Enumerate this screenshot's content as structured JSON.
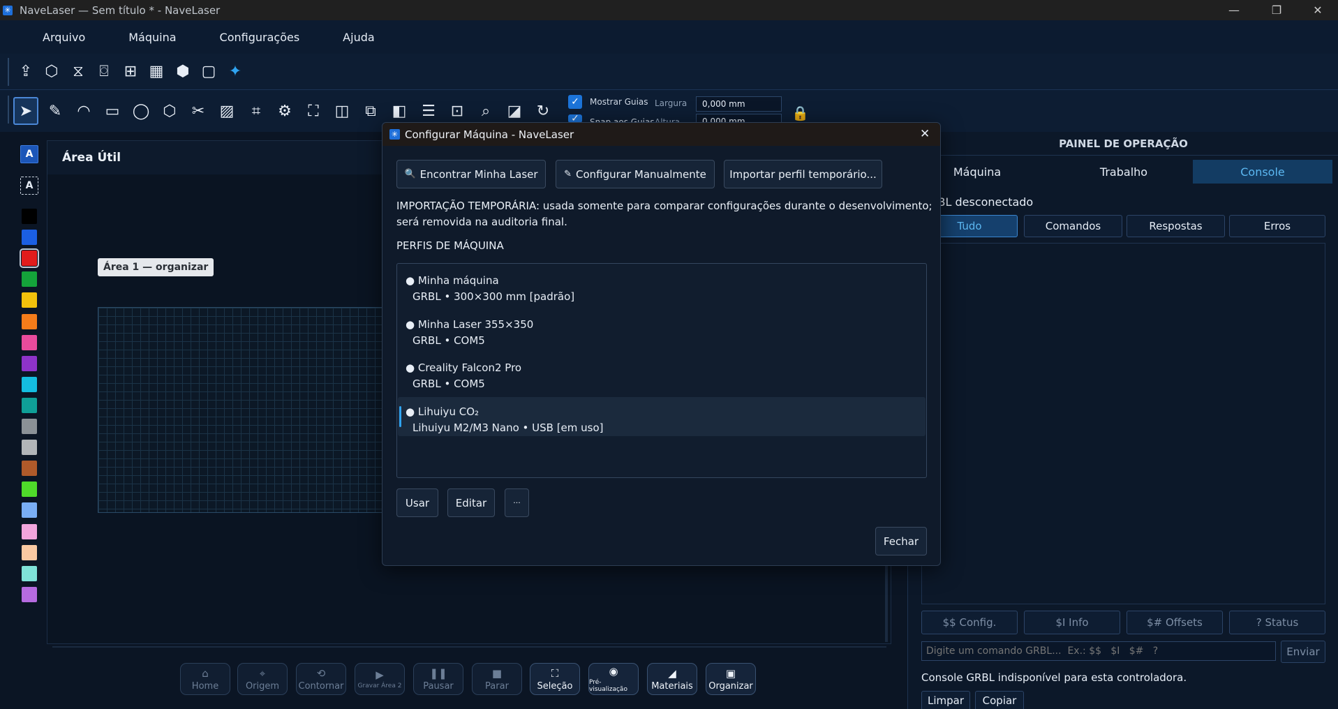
{
  "window": {
    "title": "NaveLaser — Sem título * - NaveLaser",
    "min_label": "—",
    "max_label": "❐",
    "close_label": "✕"
  },
  "menu": [
    "Arquivo",
    "Máquina",
    "Configurações",
    "Ajuda"
  ],
  "toolbar_icons": [
    "export-icon",
    "laser-head-icon",
    "mirror-icon",
    "camera-icon",
    "grid-array-icon",
    "qr-code-icon",
    "box-icon",
    "new-document-icon",
    "sparkle-icon"
  ],
  "tools_icons": [
    "select-tool-icon",
    "pen-tool-icon",
    "arc-tool-icon",
    "rectangle-tool-icon",
    "ellipse-tool-icon",
    "polygon-tool-icon",
    "scissors-icon",
    "image-icon",
    "crop-icon",
    "node-edit-icon",
    "bounding-box-icon",
    "rounded-corner-icon",
    "group-icon",
    "flip-icon",
    "align-icon",
    "offset-icon",
    "zoom-icon",
    "measure-icon",
    "rotate-icon"
  ],
  "guides": {
    "show_label": "Mostrar Guias",
    "snap_label": "Snap aos Guias",
    "width_label": "Largura",
    "height_label": "Altura",
    "width_value": "0,000 mm",
    "height_value": "0,000 mm"
  },
  "palette": {
    "text_btn": "A",
    "text_btn2": "A",
    "colors": [
      "#000000",
      "#1b5fe3",
      "#e11c1c",
      "#14a33a",
      "#f2c10c",
      "#f57c1a",
      "#e94b9c",
      "#8e33c9",
      "#14bde0",
      "#0f9f97",
      "#8b9196",
      "#b2b5b8",
      "#b05a2a",
      "#4fdb2a",
      "#7aaef5",
      "#f2a5dd",
      "#f9c9a2",
      "#7fe2d8",
      "#b66be0"
    ]
  },
  "workspace": {
    "title": "Área Útil",
    "area_label": "Área 1 — organizar"
  },
  "bottom_bar": [
    {
      "label": "Home",
      "icon": "⌂",
      "enabled": false
    },
    {
      "label": "Origem",
      "icon": "⌖",
      "enabled": false
    },
    {
      "label": "Contornar",
      "icon": "⟲",
      "enabled": false
    },
    {
      "label": "Gravar Área 2",
      "icon": "▶",
      "enabled": false
    },
    {
      "label": "Pausar",
      "icon": "❚❚",
      "enabled": false
    },
    {
      "label": "Parar",
      "icon": "■",
      "enabled": false
    },
    {
      "label": "Seleção",
      "icon": "⛶",
      "enabled": true
    },
    {
      "label": "Pré-visualização",
      "icon": "◉",
      "enabled": true
    },
    {
      "label": "Materiais",
      "icon": "◢",
      "enabled": true
    },
    {
      "label": "Organizar",
      "icon": "▣",
      "enabled": true
    }
  ],
  "panel": {
    "title": "PAINEL DE OPERAÇÃO",
    "tabs": [
      "Máquina",
      "Trabalho",
      "Console"
    ],
    "status": "GRBL desconectado",
    "filters": [
      "Tudo",
      "Comandos",
      "Respostas",
      "Erros"
    ],
    "quick": [
      "$$ Config.",
      "$I Info",
      "$# Offsets",
      "? Status"
    ],
    "cmd_placeholder": "Digite um comando GRBL...  Ex.: $$   $I   $#   ?",
    "send_label": "Enviar",
    "note": "Console GRBL indisponível para esta controladora.",
    "clear_label": "Limpar",
    "copy_label": "Copiar"
  },
  "dialog": {
    "title": "Configurar Máquina - NaveLaser",
    "close": "✕",
    "find_label": "Encontrar Minha Laser",
    "find_icon": "🔍",
    "manual_label": "Configurar Manualmente",
    "manual_icon": "✎",
    "import_label": "Importar perfil temporário...",
    "notice_line1": "IMPORTAÇÃO TEMPORÁRIA: usada somente para comparar configurações durante o desenvolvimento;",
    "notice_line2": "será removida na auditoria final.",
    "profiles_header": "PERFIS DE MÁQUINA",
    "profiles": [
      {
        "name": "● Minha máquina",
        "detail": "GRBL • 300×300 mm  [padrão]",
        "selected": false
      },
      {
        "name": "● Minha Laser 355×350",
        "detail": "GRBL • COM5",
        "selected": false
      },
      {
        "name": "● Creality Falcon2 Pro",
        "detail": "GRBL • COM5",
        "selected": false
      },
      {
        "name": "● Lihuiyu CO₂",
        "detail": "Lihuiyu M2/M3 Nano • USB  [em uso]",
        "selected": true
      }
    ],
    "use_label": "Usar",
    "edit_label": "Editar",
    "more_label": "···",
    "close_label": "Fechar"
  }
}
